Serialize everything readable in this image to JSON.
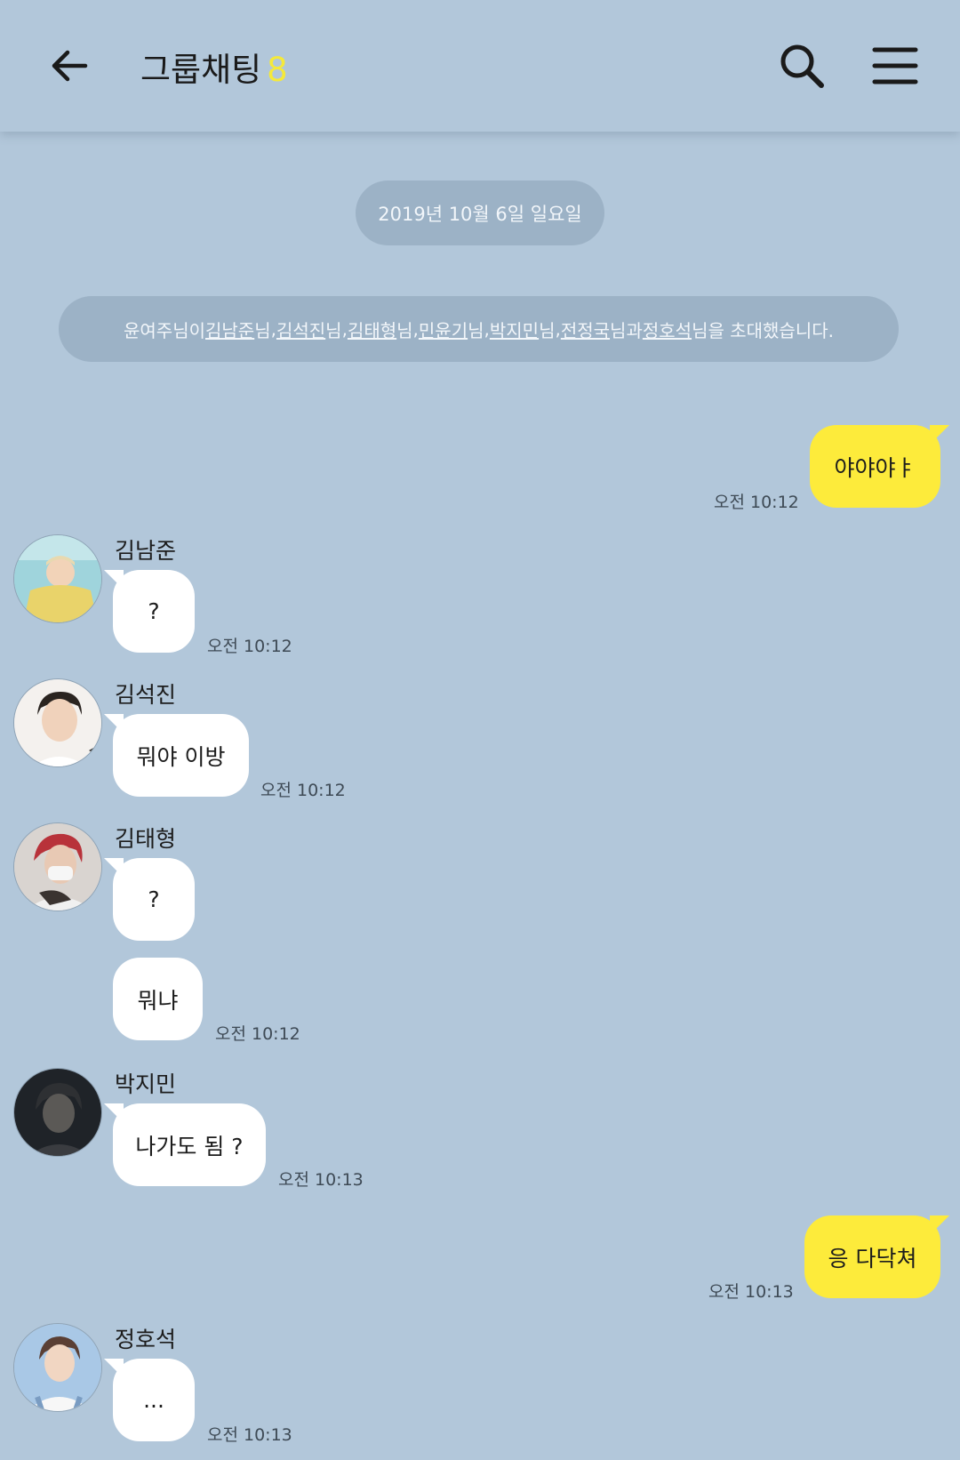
{
  "header": {
    "title": "그룹채팅",
    "member_count": "8",
    "back_icon": "arrow-left-icon",
    "search_icon": "search-icon",
    "menu_icon": "hamburger-menu-icon"
  },
  "date_divider": "2019년 10월 6일 일요일",
  "invite_notice": {
    "inviter": "윤여주님이 ",
    "invitees": [
      "김남준",
      "김석진",
      "김태형",
      "민윤기",
      "박지민",
      "전정국",
      "정호석"
    ],
    "sep_nim": "님",
    "comma": ", ",
    "conj": "님과 ",
    "suffix": "님을 초대했습니다."
  },
  "messages": {
    "m1": {
      "text": "야야야ㅑ",
      "time": "오전 10:12"
    },
    "m2": {
      "sender": "김남준",
      "text": "?",
      "time": "오전 10:12"
    },
    "m3": {
      "sender": "김석진",
      "text": "뭐야 이방",
      "time": "오전 10:12"
    },
    "m4": {
      "sender": "김태형",
      "text": "?",
      "text2": "뭐냐",
      "time": "오전 10:12"
    },
    "m5": {
      "sender": "박지민",
      "text": "나가도 됨 ?",
      "time": "오전 10:13"
    },
    "m6": {
      "text": "응 다닥쳐",
      "time": "오전 10:13"
    },
    "m7": {
      "sender": "정호석",
      "text": "...",
      "time": "오전 10:13"
    }
  },
  "colors": {
    "background": "#b2c7da",
    "my_bubble": "#fdeb3b",
    "other_bubble": "#ffffff",
    "count_accent": "#f5e93a",
    "system_pill": "#9cb2c6"
  }
}
